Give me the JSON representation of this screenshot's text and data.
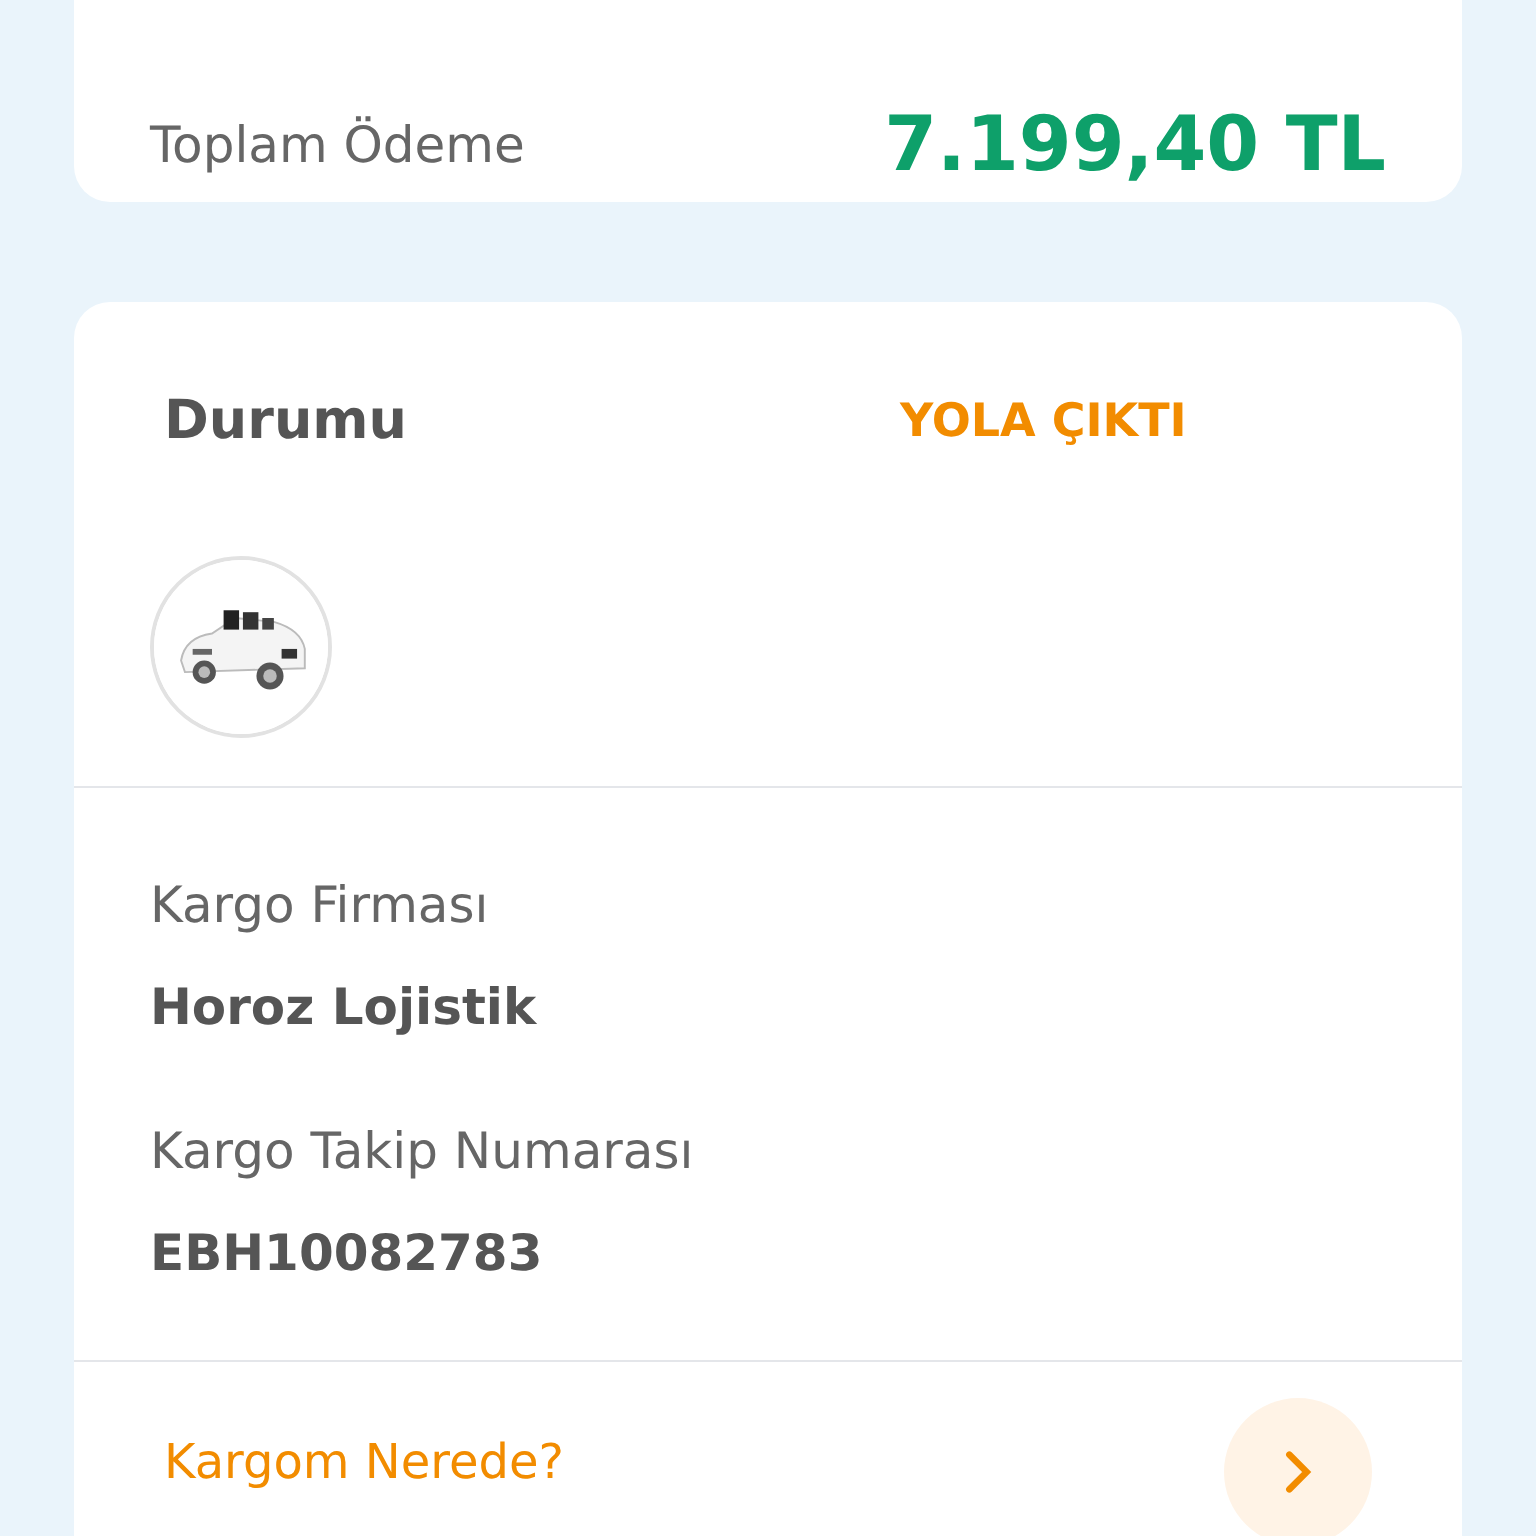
{
  "summary": {
    "total_label": "Toplam Ödeme",
    "total_value": "7.199,40 TL"
  },
  "shipment": {
    "status_label": "Durumu",
    "status_value": "YOLA ÇIKTI",
    "fields": [
      {
        "label": "Kargo Firması",
        "value": "Horoz Lojistik"
      },
      {
        "label": "Kargo Takip Numarası",
        "value": "EBH10082783"
      }
    ],
    "track_link": "Kargom Nerede?"
  }
}
